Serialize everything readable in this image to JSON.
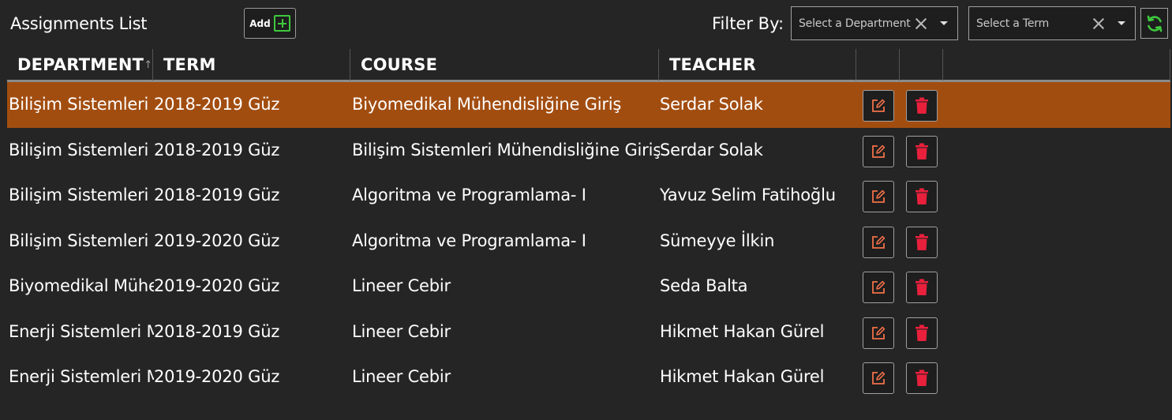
{
  "header": {
    "title": "Assignments List",
    "add_label": "Add",
    "filter_label": "Filter By:",
    "department_placeholder": "Select a Department",
    "term_placeholder": "Select a Term"
  },
  "columns": {
    "department": "DEPARTMENT",
    "term": "TERM",
    "course": "COURSE",
    "teacher": "TEACHER"
  },
  "rows": [
    {
      "department": "Bilişim Sistemleri Mühendisliği",
      "term": "2018-2019 Güz",
      "course": "Biyomedikal Mühendisliğine Giriş",
      "teacher": "Serdar Solak",
      "selected": true
    },
    {
      "department": "Bilişim Sistemleri Mühendisliği",
      "term": "2018-2019 Güz",
      "course": "Bilişim Sistemleri Mühendisliğine Giriş",
      "teacher": "Serdar Solak",
      "selected": false
    },
    {
      "department": "Bilişim Sistemleri Mühendisliği",
      "term": "2018-2019 Güz",
      "course": "Algoritma ve Programlama- I",
      "teacher": "Yavuz Selim Fatihoğlu",
      "selected": false
    },
    {
      "department": "Bilişim Sistemleri Mühendisliği",
      "term": "2019-2020 Güz",
      "course": "Algoritma ve Programlama- I",
      "teacher": "Sümeyye İlkin",
      "selected": false
    },
    {
      "department": "Biyomedikal Mühendisliği",
      "term": "2019-2020 Güz",
      "course": "Lineer Cebir",
      "teacher": "Seda Balta",
      "selected": false
    },
    {
      "department": "Enerji Sistemleri Mühendisliği",
      "term": "2018-2019 Güz",
      "course": "Lineer Cebir",
      "teacher": "Hikmet Hakan Gürel",
      "selected": false
    },
    {
      "department": "Enerji Sistemleri Mühendisliği",
      "term": "2019-2020 Güz",
      "course": "Lineer Cebir",
      "teacher": "Hikmet Hakan Gürel",
      "selected": false
    }
  ],
  "icons": {
    "add": "plus-square-icon",
    "refresh": "refresh-icon",
    "edit": "edit-icon",
    "delete": "trash-icon",
    "clear": "close-icon",
    "dropdown": "chevron-down-icon",
    "sort": "sort-ascending-icon"
  },
  "colors": {
    "background": "#252526",
    "selected_row": "#a24d10",
    "add_accent": "#3ec93e",
    "edit_icon": "#f07048",
    "delete_icon": "#e8203c",
    "refresh_icon": "#3ec93e"
  }
}
